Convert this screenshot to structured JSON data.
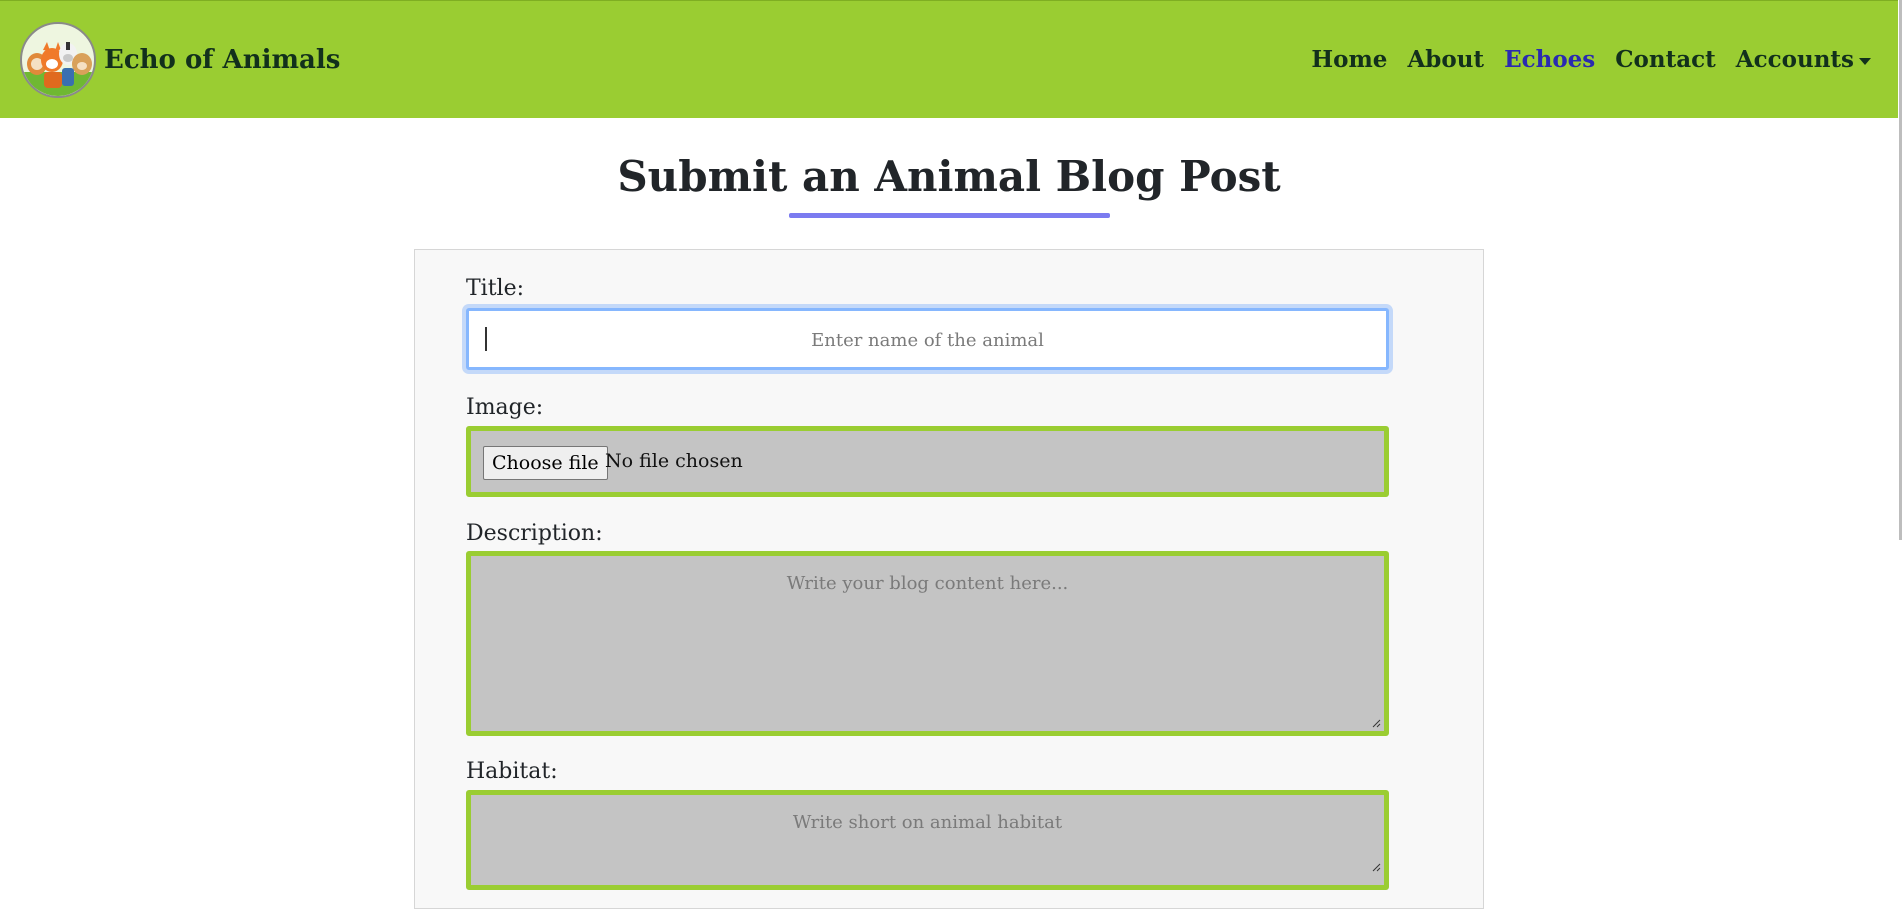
{
  "brand": {
    "name": "Echo of Animals",
    "logo_icon": "animal-group-logo-icon"
  },
  "nav": {
    "items": [
      {
        "label": "Home",
        "active": false
      },
      {
        "label": "About",
        "active": false
      },
      {
        "label": "Echoes",
        "active": true
      },
      {
        "label": "Contact",
        "active": false
      },
      {
        "label": "Accounts",
        "active": false,
        "dropdown": true
      }
    ]
  },
  "page": {
    "title": "Submit an Animal Blog Post"
  },
  "form": {
    "title_label": "Title:",
    "title_placeholder": "Enter name of the animal",
    "image_label": "Image:",
    "file_button": "Choose file",
    "file_status": "No file chosen",
    "description_label": "Description:",
    "description_placeholder": "Write your blog content here...",
    "habitat_label": "Habitat:",
    "habitat_placeholder": "Write short on animal habitat"
  },
  "colors": {
    "navbar": "#9acd32",
    "active_link": "#2a2ab0",
    "title_underline": "#7b7bf0",
    "field_border": "#9acd32",
    "field_fill": "#c4c4c4",
    "focus_border": "#86b7fe"
  }
}
